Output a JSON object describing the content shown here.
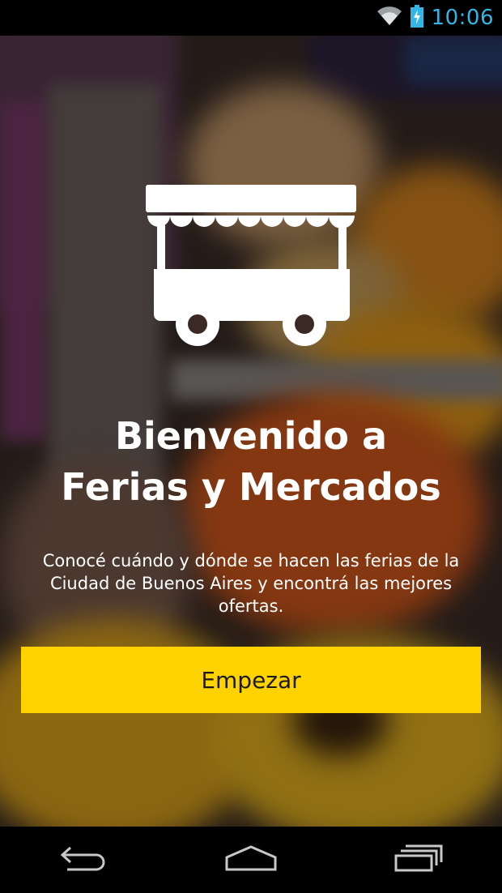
{
  "status_bar": {
    "time": "10:06",
    "wifi_icon": "wifi-icon",
    "battery_icon": "battery-charging-icon",
    "accent_color": "#33b5e5"
  },
  "welcome": {
    "title_line1": "Bienvenido a",
    "title_line2": "Ferias y Mercados",
    "description": "Conocé cuándo y dónde se hacen las ferias de la Ciudad de Buenos Aires y encontrá las mejores ofertas.",
    "logo_icon": "market-cart-icon",
    "start_button_label": "Empezar",
    "button_color": "#ffd200"
  },
  "nav_bar": {
    "back_icon": "back-icon",
    "home_icon": "home-icon",
    "recents_icon": "recent-apps-icon"
  }
}
